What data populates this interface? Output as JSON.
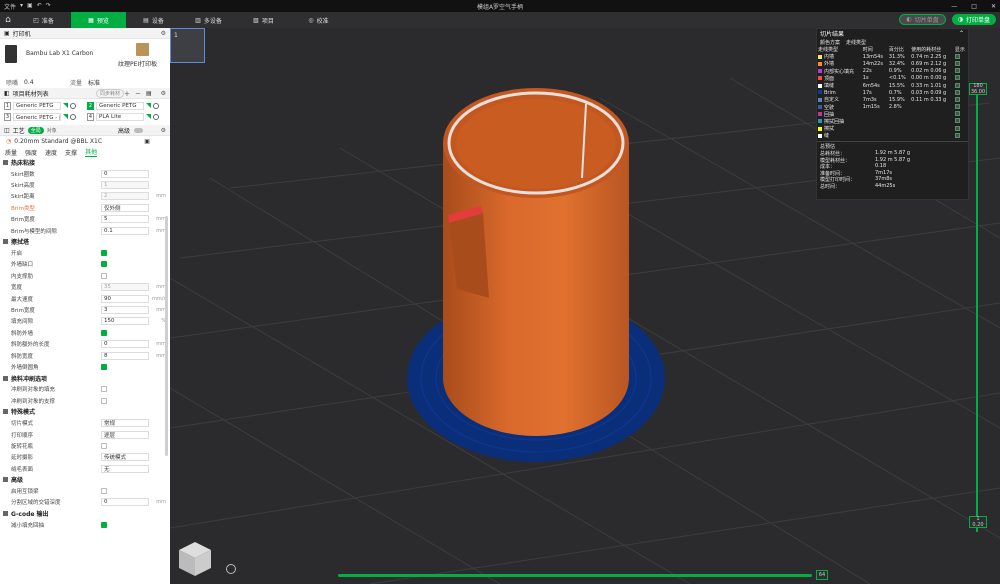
{
  "titlebar": {
    "menu_label": "文件",
    "title": "模组A罗空气手柄",
    "win_min": "—",
    "win_max": "□",
    "win_close": "✕"
  },
  "nav": {
    "tabs": [
      {
        "label": "准备"
      },
      {
        "label": "预览"
      },
      {
        "label": "设备"
      },
      {
        "label": "多设备"
      },
      {
        "label": "项目"
      },
      {
        "label": "校准"
      }
    ],
    "slice_plate": "切片单盘",
    "print_plate": "打印单盘"
  },
  "printer": {
    "section": "打印机",
    "name": "Bambu Lab X1 Carbon",
    "plate": "纹理PEI打印板",
    "nozzle_label": "喷嘴",
    "nozzle_value": "0.4",
    "flow_label": "流量",
    "flow_value": "标准"
  },
  "filaments": {
    "section": "项目耗材列表",
    "sync_btn": "同步耗材",
    "items": [
      {
        "num": "1",
        "name": "Generic PETG",
        "color": "#ffffff"
      },
      {
        "num": "2",
        "name": "Generic PETG",
        "color": "#ffffff",
        "active": true
      },
      {
        "num": "3",
        "name": "Generic PETG - 此...",
        "color": "#333333"
      },
      {
        "num": "4",
        "name": "PLA Lite",
        "color": "#222222"
      }
    ]
  },
  "process": {
    "section": "工艺",
    "global": "全局",
    "object": "对象",
    "advanced": "高级",
    "preset": "0.20mm Standard @BBL X1C",
    "subtabs": [
      "质量",
      "强度",
      "速度",
      "支撑",
      "其他"
    ],
    "active_subtab": 4
  },
  "groups": [
    {
      "title": "热床粘接",
      "items": [
        {
          "label": "Skirt圈数",
          "type": "num",
          "value": "0"
        },
        {
          "label": "Skirt高度",
          "type": "num",
          "value": "1",
          "dis": true
        },
        {
          "label": "Skirt距离",
          "type": "num",
          "value": "2",
          "unit": "mm",
          "dis": true
        },
        {
          "label": "Brim类型",
          "type": "select",
          "value": "仅外侧",
          "orange": true
        },
        {
          "label": "Brim宽度",
          "type": "num",
          "value": "5",
          "unit": "mm"
        },
        {
          "label": "Brim与模型的间隙",
          "type": "num",
          "value": "0.1",
          "unit": "mm"
        }
      ]
    },
    {
      "title": "擦拭塔",
      "items": [
        {
          "label": "开启",
          "type": "chk",
          "value": true
        },
        {
          "label": "外墙缺口",
          "type": "chk",
          "value": true
        },
        {
          "label": "内支撑肋",
          "type": "chk",
          "value": false
        },
        {
          "label": "宽度",
          "type": "num",
          "value": "35",
          "unit": "mm",
          "dis": true
        },
        {
          "label": "最大速度",
          "type": "num",
          "value": "90",
          "unit": "mm/s"
        },
        {
          "label": "Brim宽度",
          "type": "num",
          "value": "3",
          "unit": "mm"
        },
        {
          "label": "填充间隙",
          "type": "num",
          "value": "150",
          "unit": "%"
        },
        {
          "label": "斜防外墙",
          "type": "chk",
          "value": true
        },
        {
          "label": "斜防额外的长度",
          "type": "num",
          "value": "0",
          "unit": "mm"
        },
        {
          "label": "斜防宽度",
          "type": "num",
          "value": "8",
          "unit": "mm"
        },
        {
          "label": "外墙倒圆角",
          "type": "chk",
          "value": true
        }
      ]
    },
    {
      "title": "换料冲刷选项",
      "items": [
        {
          "label": "冲刷到对象的填充",
          "type": "chk",
          "value": false
        },
        {
          "label": "冲刷到对象的支撑",
          "type": "chk",
          "value": false
        }
      ]
    },
    {
      "title": "特殊模式",
      "items": [
        {
          "label": "切片模式",
          "type": "select",
          "value": "常规"
        },
        {
          "label": "打印顺序",
          "type": "select",
          "value": "逐层"
        },
        {
          "label": "旋转花瓶",
          "type": "chk",
          "value": false
        },
        {
          "label": "延时摄影",
          "type": "select",
          "value": "传统模式"
        },
        {
          "label": "绒毛表面",
          "type": "select",
          "value": "无"
        }
      ]
    },
    {
      "title": "高级",
      "items": [
        {
          "label": "启用互锁梁",
          "type": "chk",
          "value": false
        },
        {
          "label": "分割区域的交错深度",
          "type": "num",
          "value": "0",
          "unit": "mm"
        }
      ]
    },
    {
      "title": "G-code 输出",
      "items": [
        {
          "label": "减小填充回抽",
          "type": "chk",
          "value": true
        }
      ]
    }
  ],
  "viewport": {
    "plate_num": "1",
    "slider_top": "180\n36.00",
    "slider_bottom": "1\n0.20",
    "h_slider_value": "64"
  },
  "slicing": {
    "title": "切片结果",
    "scheme_label": "颜色方案",
    "scheme_value": "走线类型",
    "headers": [
      "走线类型",
      "时间",
      "百分比",
      "使用的耗材丝",
      "显示"
    ],
    "rows": [
      {
        "name": "内墙",
        "color": "#ffe46b",
        "time": "13m54s",
        "pct": "31.3%",
        "use": "0.74 m  2.25 g"
      },
      {
        "name": "外墙",
        "color": "#ff8c21",
        "time": "14m22s",
        "pct": "32.4%",
        "use": "0.69 m  2.12 g"
      },
      {
        "name": "内部实心填充",
        "color": "#b03de4",
        "time": "22s",
        "pct": "0.9%",
        "use": "0.02 m  0.06 g"
      },
      {
        "name": "顶面",
        "color": "#ff4848",
        "time": "1s",
        "pct": "<0.1%",
        "use": "0.00 m  0.00 g"
      },
      {
        "name": "填缝",
        "color": "#ffffff",
        "time": "6m54s",
        "pct": "15.5%",
        "use": "0.33 m  1.01 g"
      },
      {
        "name": "Brim",
        "color": "#0a3b9e",
        "time": "17s",
        "pct": "0.7%",
        "use": "0.03 m  0.09 g"
      },
      {
        "name": "自定义",
        "color": "#5e82c0",
        "time": "7m3s",
        "pct": "15.9%",
        "use": "0.11 m  0.33 g"
      },
      {
        "name": "空驶",
        "color": "#3c5a9c",
        "time": "1m15s",
        "pct": "2.8%",
        "use": ""
      },
      {
        "name": "回抽",
        "color": "#c3349c",
        "time": "",
        "pct": "",
        "use": ""
      },
      {
        "name": "擦拭回抽",
        "color": "#1d9bb9",
        "time": "",
        "pct": "",
        "use": ""
      },
      {
        "name": "擦拭",
        "color": "#ffff00",
        "time": "",
        "pct": "",
        "use": ""
      },
      {
        "name": "缝",
        "color": "#ffffff",
        "time": "",
        "pct": "",
        "use": ""
      }
    ],
    "total_title": "总预估",
    "totals": [
      {
        "k": "总耗材丝：",
        "v": "1.92 m  5.87 g"
      },
      {
        "k": "模型耗材丝：",
        "v": "1.92 m  5.87 g"
      },
      {
        "k": "成本：",
        "v": "0.18"
      },
      {
        "k": "准备时间：",
        "v": "7m17s"
      },
      {
        "k": "模型打印时间：",
        "v": "37m8s"
      },
      {
        "k": "总时间：",
        "v": "44m25s"
      }
    ]
  }
}
